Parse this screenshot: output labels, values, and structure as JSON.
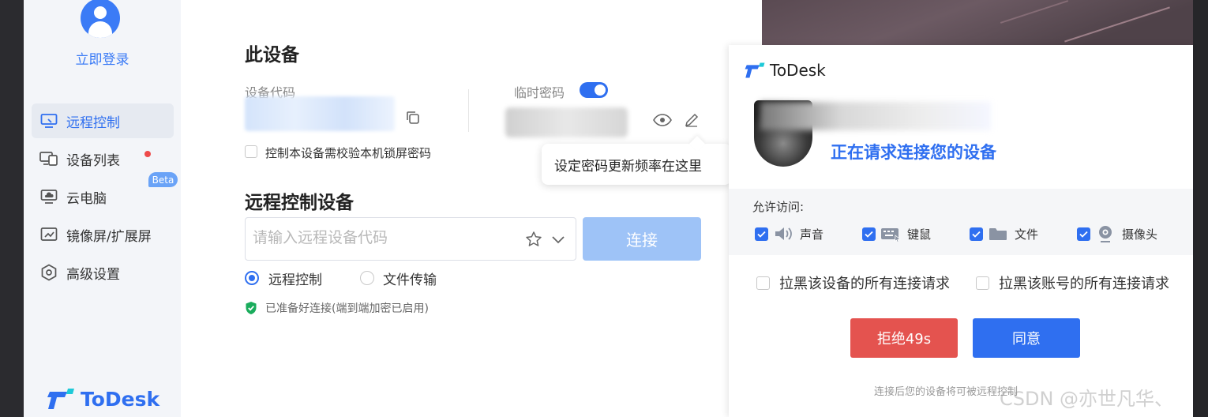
{
  "sidebar": {
    "login": "立即登录",
    "items": [
      {
        "label": "远程控制",
        "icon": "monitor-icon",
        "active": true
      },
      {
        "label": "设备列表",
        "icon": "device-list-icon"
      },
      {
        "label": "云电脑",
        "icon": "cloud-pc-icon",
        "badge": "Beta"
      },
      {
        "label": "镜像屏/扩展屏",
        "icon": "screen-mirror-icon"
      },
      {
        "label": "高级设置",
        "icon": "settings-icon"
      }
    ],
    "brand": "ToDesk"
  },
  "this_device": {
    "title": "此设备",
    "code_label": "设备代码",
    "temp_password_label": "临时密码",
    "temp_password_enabled": true,
    "lock_check_label": "控制本设备需校验本机锁屏密码",
    "tooltip": "设定密码更新频率在这里"
  },
  "remote": {
    "title": "远程控制设备",
    "input_placeholder": "请输入远程设备代码",
    "connect_label": "连接",
    "mode_remote": "远程控制",
    "mode_file": "文件传输",
    "status": "已准备好连接(端到端加密已启用)"
  },
  "popup": {
    "brand": "ToDesk",
    "request_text": "正在请求连接您的设备",
    "permissions_title": "允许访问:",
    "permissions": [
      {
        "label": "声音",
        "icon": "speaker-icon",
        "checked": true
      },
      {
        "label": "键鼠",
        "icon": "keyboard-icon",
        "checked": true
      },
      {
        "label": "文件",
        "icon": "folder-icon",
        "checked": true
      },
      {
        "label": "摄像头",
        "icon": "camera-icon",
        "checked": true
      }
    ],
    "block_device": "拉黑该设备的所有连接请求",
    "block_account": "拉黑该账号的所有连接请求",
    "reject_label": "拒绝49s",
    "agree_label": "同意",
    "footer": "连接后您的设备将可被远程控制"
  },
  "watermark": "CSDN @亦世凡华、",
  "colors": {
    "accent": "#2f6ff0",
    "reject": "#e4534f",
    "connect_disabled": "#9ec3f7"
  }
}
